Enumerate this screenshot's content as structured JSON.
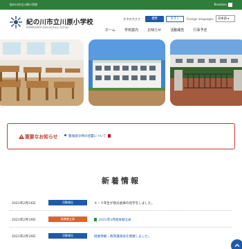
{
  "topbar": {
    "left_text": "紀の川市立川原小学校",
    "right_text": "Besetzen"
  },
  "header": {
    "title": "紀の川市立川原小学校",
    "subtitle": "KAWAHARA Elementary School",
    "fontsize_label": "文字の大きさ",
    "fontsize_standard": "標準",
    "fontsize_large": "大きく",
    "language_label": "Foreign languages",
    "language_selected": "日本語"
  },
  "nav": {
    "items": [
      "ホーム",
      "学校案内",
      "お知らせ",
      "活動報告",
      "行事予定"
    ]
  },
  "notice": {
    "title": "重要なお知らせ",
    "link": "警報発令時の措置について"
  },
  "news": {
    "heading": "新着情報",
    "items": [
      {
        "date": "2021年2月24日",
        "category": "活動報告",
        "title": "４・５年生が防災倉庫の見学をしました。"
      },
      {
        "date": "2021年2月19日",
        "category": "給食献立表",
        "title": "2021年3月給食献立表"
      },
      {
        "date": "2021年2月19日",
        "category": "活動報告",
        "title": "授業参観・教育講演会を開催しました。"
      }
    ]
  },
  "colors": {
    "topbar": "#2f7d3a",
    "accent_blue": "#1f5aa6",
    "warning_red": "#c0392b",
    "category_activity": "#1f5aa6",
    "category_lunch": "#e0622b"
  },
  "icons": {
    "logo": "school-emblem-icon",
    "warning": "warning-icon",
    "pdf": "pdf-icon",
    "excel": "excel-icon",
    "back_to_top": "chevron-up-icon"
  }
}
